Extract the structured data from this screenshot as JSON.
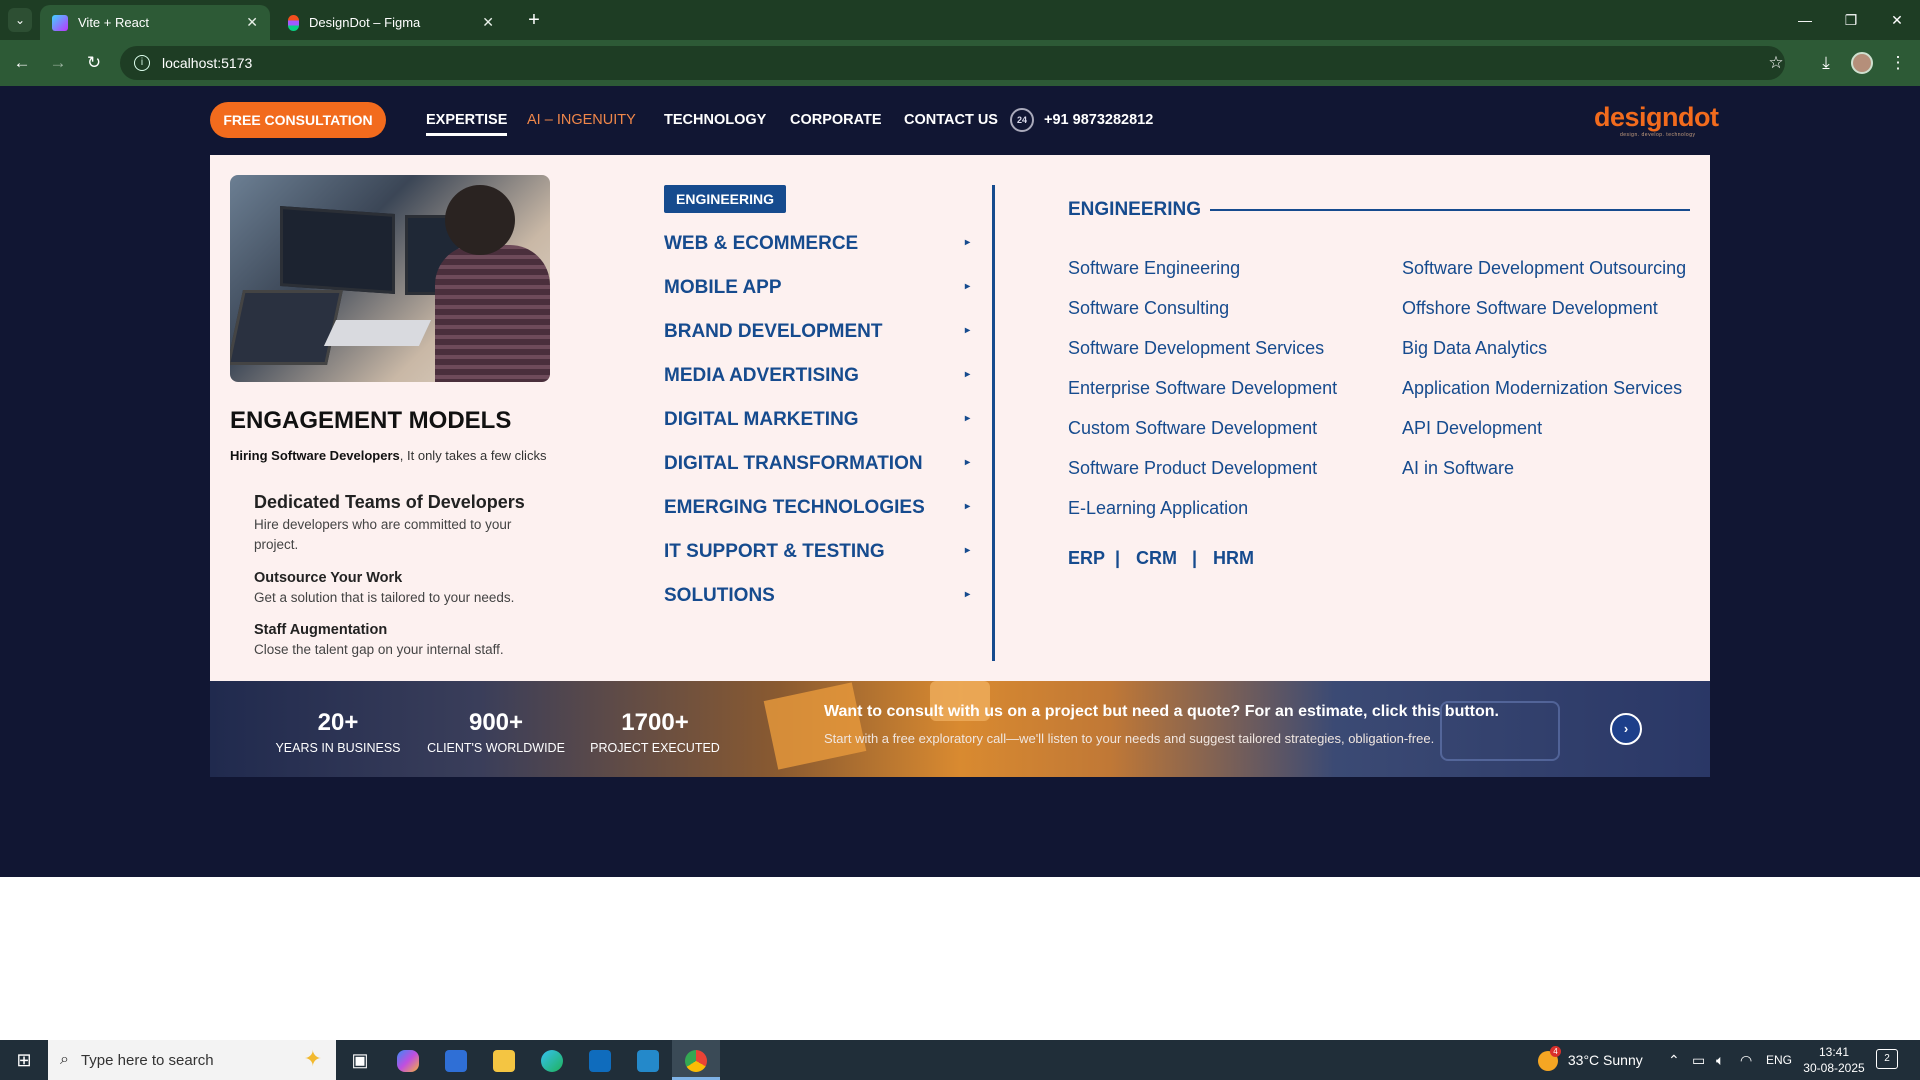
{
  "browser": {
    "tabs": [
      {
        "title": "Vite + React",
        "active": true
      },
      {
        "title": "DesignDot – Figma",
        "active": false
      }
    ],
    "url": "localhost:5173"
  },
  "site": {
    "cta": "FREE CONSULTATION",
    "nav": [
      "EXPERTISE",
      "AI – INGENUITY",
      "TECHNOLOGY",
      "CORPORATE",
      "CONTACT US"
    ],
    "phone_icon": "24",
    "phone": "+91 9873282812",
    "logo": "designdot",
    "logo_tagline": "design. develop. technology"
  },
  "mega": {
    "engagement_title": "ENGAGEMENT MODELS",
    "engagement_sub_bold": "Hiring Software Developers",
    "engagement_sub_rest": ", It only takes a few clicks",
    "models": [
      {
        "title": "Dedicated Teams of Developers",
        "desc": "Hire developers who are committed to your project."
      },
      {
        "title": "Outsource Your Work",
        "desc": "Get a solution that is tailored to your needs."
      },
      {
        "title": "Staff Augmentation",
        "desc": "Close the talent gap on your internal staff."
      }
    ],
    "badge": "ENGINEERING",
    "categories": [
      "WEB & ECOMMERCE",
      "MOBILE APP",
      "BRAND DEVELOPMENT",
      "MEDIA ADVERTISING",
      "DIGITAL MARKETING",
      "DIGITAL TRANSFORMATION",
      "EMERGING TECHNOLOGIES",
      "IT SUPPORT & TESTING",
      "SOLUTIONS"
    ],
    "section_title": "ENGINEERING",
    "services_left": [
      "Software Engineering",
      "Software Consulting",
      "Software Development Services",
      "Enterprise Software Development",
      "Custom Software Development",
      "Software Product Development",
      "E-Learning Application"
    ],
    "services_right": [
      "Software Development Outsourcing",
      "Offshore Software Development",
      "Big Data Analytics",
      "Application Modernization Services",
      "API Development",
      "AI in Software"
    ],
    "erp_links": [
      "ERP",
      "|",
      "CRM",
      "|",
      "HRM"
    ]
  },
  "stats": {
    "items": [
      {
        "num": "20+",
        "label": "YEARS IN BUSINESS"
      },
      {
        "num": "900+",
        "label": "CLIENT'S WORLDWIDE"
      },
      {
        "num": "1700+",
        "label": "PROJECT EXECUTED"
      }
    ],
    "quote_title": "Want to consult with us on a project but need a quote? For an estimate, click this button.",
    "quote_sub": "Start with a free exploratory call—we'll listen to your needs and suggest tailored strategies, obligation-free."
  },
  "taskbar": {
    "search_placeholder": "Type here to search",
    "weather_badge": "4",
    "weather": "33°C  Sunny",
    "lang": "ENG",
    "time": "13:41",
    "date": "30-08-2025",
    "notifications": "2"
  },
  "colors": {
    "accent_orange": "#f26b1d",
    "brand_blue": "#164b8e",
    "page_bg": "#111633",
    "chrome_green": "#2d5a36"
  }
}
